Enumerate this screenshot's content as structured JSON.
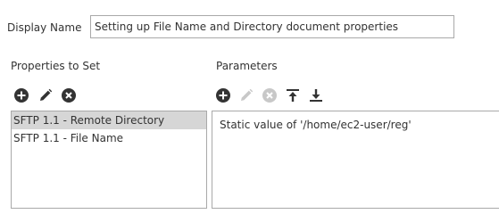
{
  "display_name": {
    "label": "Display Name",
    "value": "Setting up File Name and Directory document properties"
  },
  "properties_to_set": {
    "heading": "Properties to Set",
    "toolbar": [
      {
        "icon": "add-icon",
        "enabled": true
      },
      {
        "icon": "edit-icon",
        "enabled": true
      },
      {
        "icon": "remove-icon",
        "enabled": true
      }
    ],
    "items": [
      {
        "label": "SFTP 1.1 - Remote Directory",
        "selected": true
      },
      {
        "label": "SFTP 1.1 - File Name",
        "selected": false
      }
    ]
  },
  "parameters": {
    "heading": "Parameters",
    "toolbar": [
      {
        "icon": "add-icon",
        "enabled": true
      },
      {
        "icon": "edit-icon",
        "enabled": false
      },
      {
        "icon": "remove-icon",
        "enabled": false
      },
      {
        "icon": "move-to-top-icon",
        "enabled": true
      },
      {
        "icon": "move-to-bottom-icon",
        "enabled": true
      }
    ],
    "items": [
      {
        "label": "Static value of '/home/ec2-user/reg'"
      }
    ]
  },
  "colors": {
    "icon_enabled": "#333333",
    "icon_disabled": "#c8c8c8",
    "selected_row": "#d6d6d6",
    "border": "#a9a9a9"
  }
}
